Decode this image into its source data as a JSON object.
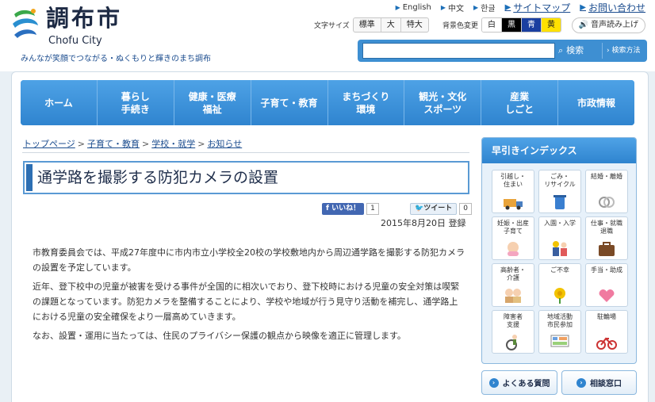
{
  "header": {
    "city_name": "調布市",
    "city_name_en": "Chofu City",
    "slogan": "みんなが笑顔でつながる・ぬくもりと輝きのまち調布",
    "top_links": [
      "English",
      "中文",
      "한글"
    ],
    "sitemap": "サイトマップ",
    "contact": "お問い合わせ",
    "font_size_label": "文字サイズ",
    "font_sizes": [
      "標準",
      "大",
      "特大"
    ],
    "bg_color_label": "背景色変更",
    "bg_colors": [
      {
        "label": "白",
        "bg": "#ffffff",
        "fg": "#222222"
      },
      {
        "label": "黒",
        "bg": "#000000",
        "fg": "#ffffff"
      },
      {
        "label": "青",
        "bg": "#1a3fa0",
        "fg": "#ffffff"
      },
      {
        "label": "黄",
        "bg": "#ffe100",
        "fg": "#222222"
      }
    ],
    "voice": "音声読み上げ",
    "search_button": "検索",
    "advanced_search": "検索方法"
  },
  "nav": [
    "ホーム",
    "暮らし\n手続き",
    "健康・医療\n福祉",
    "子育て・教育",
    "まちづくり\n環境",
    "観光・文化\nスポーツ",
    "産業\nしごと",
    "市政情報"
  ],
  "breadcrumb": [
    "トップページ",
    "子育て・教育",
    "学校・就学",
    "お知らせ"
  ],
  "breadcrumb_sep": ">",
  "page_title": "通学路を撮影する防犯カメラの設置",
  "social": {
    "like": "いいね！",
    "like_count": "1",
    "tweet": "ツイート",
    "tweet_count": "0"
  },
  "date": "2015年8月20日",
  "date_suffix": "登録",
  "body": [
    "市教育委員会では、平成27年度中に市内市立小学校全20校の学校敷地内から周辺通学路を撮影する防犯カメラの設置を予定しています。",
    "近年、登下校中の児童が被害を受ける事件が全国的に相次いでおり、登下校時における児童の安全対策は喫緊の課題となっています。防犯カメラを整備することにより、学校や地域が行う見守り活動を補完し、通学路上における児童の安全確保をより一層高めていきます。",
    "なお、設置・運用に当たっては、住民のプライバシー保護の観点から映像を適正に管理します。"
  ],
  "sidebar": {
    "title": "早引きインデックス",
    "tiles": [
      {
        "label": "引越し・\n住まい",
        "icon": "moving-truck-icon"
      },
      {
        "label": "ごみ・\nリサイクル",
        "icon": "recycle-bin-icon"
      },
      {
        "label": "結婚・離婚",
        "icon": "rings-icon"
      },
      {
        "label": "妊娠・出産\n子育て",
        "icon": "baby-icon"
      },
      {
        "label": "入園・入学",
        "icon": "school-kids-icon"
      },
      {
        "label": "仕事・就職\n退職",
        "icon": "briefcase-icon"
      },
      {
        "label": "高齢者・\n介護",
        "icon": "elderly-couple-icon"
      },
      {
        "label": "ご不幸",
        "icon": "chrysanthemum-icon"
      },
      {
        "label": "手当・助成",
        "icon": "heart-hand-icon"
      },
      {
        "label": "障害者\n支援",
        "icon": "wheelchair-icon"
      },
      {
        "label": "地域活動\n市民参加",
        "icon": "community-board-icon"
      },
      {
        "label": "駐輪場",
        "icon": "bicycle-icon"
      }
    ],
    "faq": "よくある質問",
    "consult": "相談窓口"
  },
  "colors": {
    "accent": "#2f84cf",
    "title_bar": "#2d6fb3",
    "link": "#1c4d8f"
  }
}
